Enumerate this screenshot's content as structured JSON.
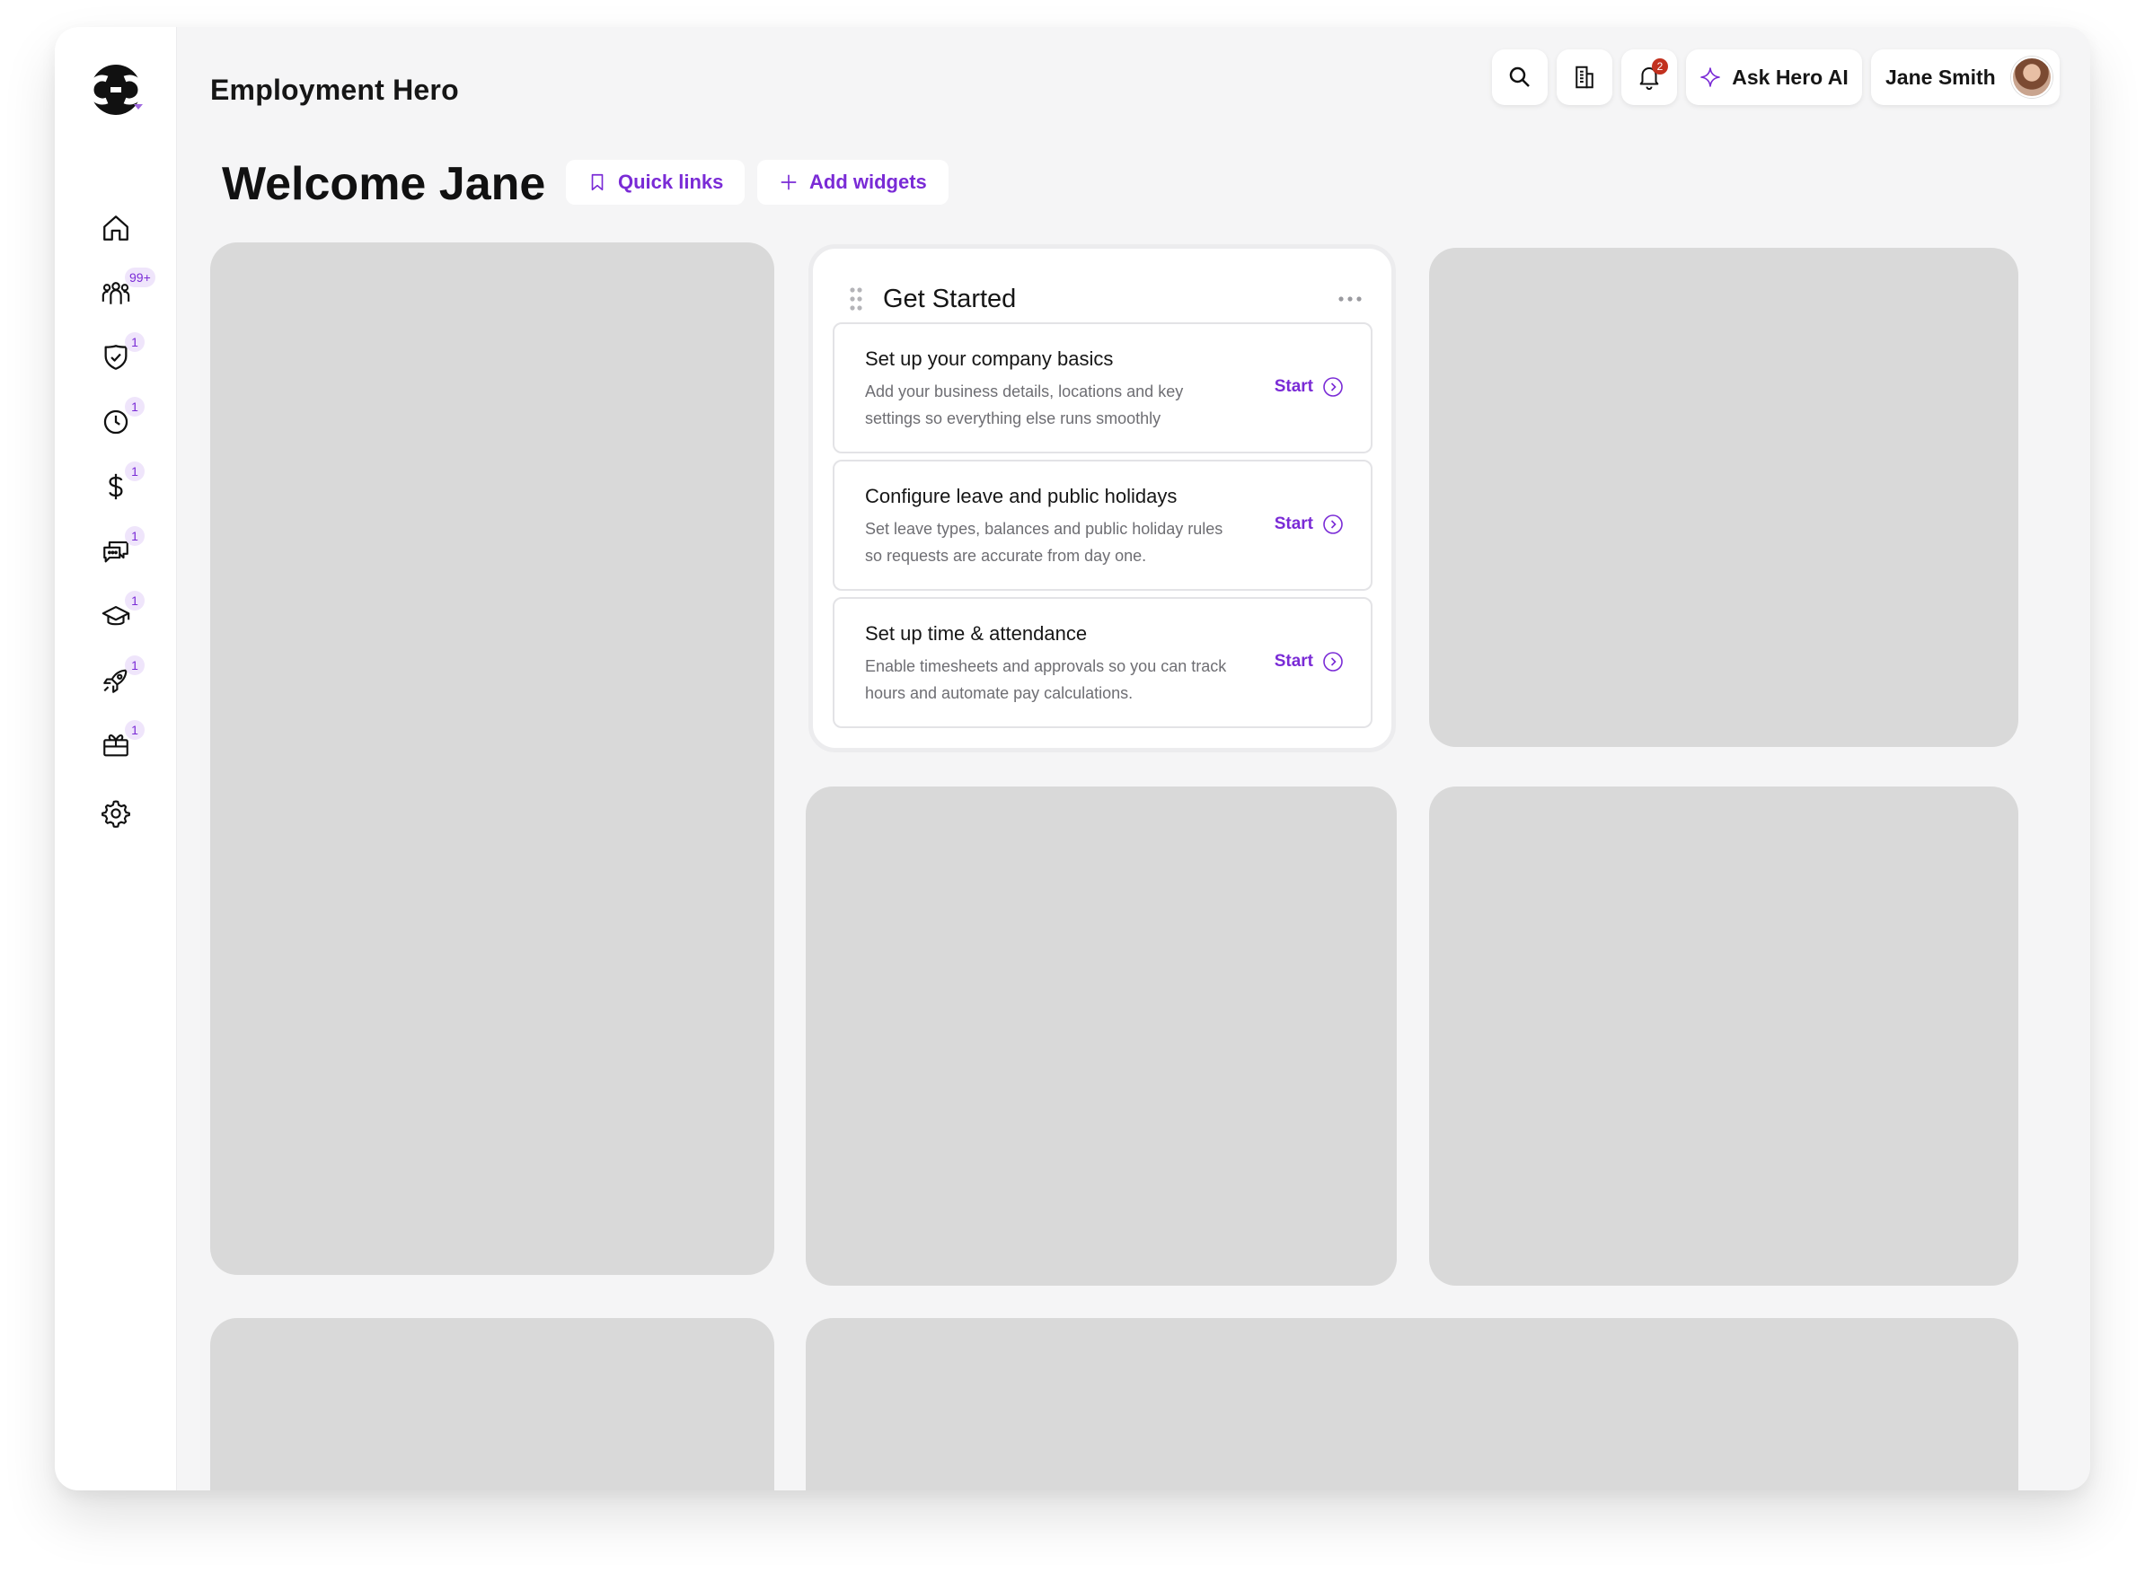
{
  "app": {
    "brand": "Employment Hero"
  },
  "colors": {
    "accent": "#7a2bd6",
    "badge_bg": "#efe5fb",
    "alert": "#c2311f",
    "placeholder": "#d9d9d9"
  },
  "sidebar": {
    "items": [
      {
        "name": "home",
        "icon": "home-icon",
        "badge": ""
      },
      {
        "name": "people",
        "icon": "people-icon",
        "badge": "99+"
      },
      {
        "name": "compliance",
        "icon": "shield-check-icon",
        "badge": "1"
      },
      {
        "name": "time",
        "icon": "clock-icon",
        "badge": "1"
      },
      {
        "name": "payroll",
        "icon": "dollar-icon",
        "badge": "1"
      },
      {
        "name": "messages",
        "icon": "chat-icon",
        "badge": "1"
      },
      {
        "name": "learning",
        "icon": "graduation-cap-icon",
        "badge": "1"
      },
      {
        "name": "benefits",
        "icon": "rocket-icon",
        "badge": "1"
      },
      {
        "name": "rewards",
        "icon": "gift-icon",
        "badge": "1"
      },
      {
        "name": "settings",
        "icon": "gear-icon",
        "badge": ""
      }
    ]
  },
  "header": {
    "notifications_count": "2",
    "ask_ai_label": "Ask Hero AI",
    "user_name": "Jane Smith"
  },
  "main": {
    "welcome": "Welcome Jane",
    "quick_links_label": "Quick links",
    "add_widgets_label": "Add widgets"
  },
  "get_started": {
    "title": "Get Started",
    "tasks": [
      {
        "title": "Set up your company basics",
        "description": "Add your business details, locations and key settings so everything else runs smoothly",
        "action": "Start"
      },
      {
        "title": "Configure leave and public holidays",
        "description": "Set leave types, balances and public holiday rules so requests are accurate from day one.",
        "action": "Start"
      },
      {
        "title": "Set up time & attendance",
        "description": "Enable timesheets and approvals so you can track hours and automate pay calculations.",
        "action": "Start"
      }
    ]
  }
}
